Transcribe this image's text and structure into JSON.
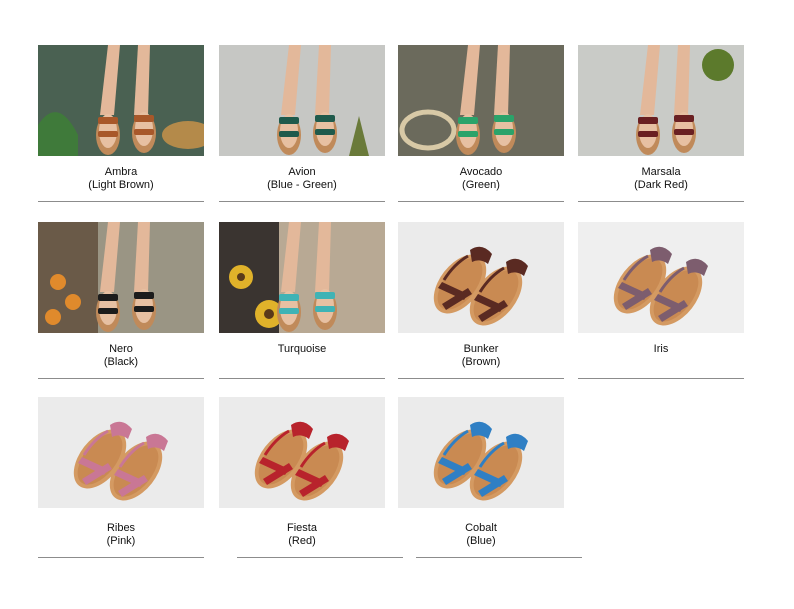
{
  "products": [
    {
      "name": "Ambra",
      "color_label": "(Light Brown)",
      "photo": "lifestyle-sandal-photo",
      "bg": "#4a6152",
      "strap": "#a8582a"
    },
    {
      "name": "Avion",
      "color_label": "(Blue - Green)",
      "photo": "lifestyle-sandal-photo",
      "bg": "#b7b8b6",
      "strap": "#1f5a4c"
    },
    {
      "name": "Avocado",
      "color_label": "(Green)",
      "photo": "lifestyle-sandal-photo",
      "bg": "#6b6a5c",
      "strap": "#2ba36a"
    },
    {
      "name": "Marsala",
      "color_label": "(Dark Red)",
      "photo": "lifestyle-sandal-photo",
      "bg": "#c9cbc7",
      "strap": "#6a2022"
    },
    {
      "name": "Nero",
      "color_label": "(Black)",
      "photo": "lifestyle-sandal-photo",
      "bg": "#9a9584",
      "strap": "#1c1c1c"
    },
    {
      "name": "Turquoise",
      "color_label": "",
      "photo": "lifestyle-sandal-photo",
      "bg": "#b8a994",
      "strap": "#3fb3b5"
    },
    {
      "name": "Bunker",
      "color_label": "(Brown)",
      "photo": "product-sandal-photo",
      "bg": "#ebebeb",
      "strap": "#5a2a22"
    },
    {
      "name": "Iris",
      "color_label": "",
      "photo": "product-sandal-photo",
      "bg": "#efefef",
      "strap": "#7d5d6e"
    },
    {
      "name": "Ribes",
      "color_label": "(Pink)",
      "photo": "product-sandal-photo",
      "bg": "#ebebeb",
      "strap": "#c97795"
    },
    {
      "name": "Fiesta",
      "color_label": "(Red)",
      "photo": "product-sandal-photo",
      "bg": "#ebebeb",
      "strap": "#b8232c"
    },
    {
      "name": "Cobalt",
      "color_label": "(Blue)",
      "photo": "product-sandal-photo",
      "bg": "#ebebeb",
      "strap": "#2f7fc4"
    }
  ]
}
